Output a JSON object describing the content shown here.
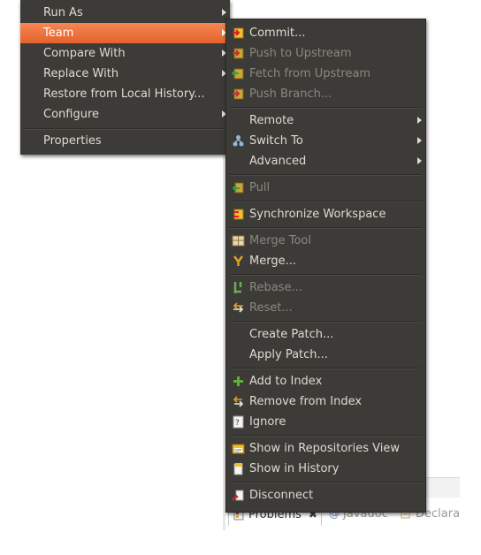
{
  "main_menu": {
    "items": [
      {
        "label": "Run As",
        "has_submenu": true
      },
      {
        "label": "Team",
        "has_submenu": true,
        "highlighted": true
      },
      {
        "label": "Compare With",
        "has_submenu": true
      },
      {
        "label": "Replace With",
        "has_submenu": true
      },
      {
        "label": "Restore from Local History...",
        "has_submenu": false
      },
      {
        "label": "Configure",
        "has_submenu": true
      },
      {
        "label": "Properties",
        "has_submenu": false
      }
    ]
  },
  "team_menu": {
    "items": [
      {
        "label": "Commit...",
        "icon": "commit-icon",
        "enabled": true
      },
      {
        "label": "Push to Upstream",
        "icon": "push-icon",
        "enabled": false
      },
      {
        "label": "Fetch from Upstream",
        "icon": "fetch-icon",
        "enabled": false
      },
      {
        "label": "Push Branch...",
        "icon": "push-branch-icon",
        "enabled": false
      },
      {
        "label": "Remote",
        "enabled": true,
        "has_submenu": true
      },
      {
        "label": "Switch To",
        "icon": "switch-branch-icon",
        "enabled": true,
        "has_submenu": true
      },
      {
        "label": "Advanced",
        "enabled": true,
        "has_submenu": true
      },
      {
        "label": "Pull",
        "icon": "pull-icon",
        "enabled": false
      },
      {
        "label": "Synchronize Workspace",
        "icon": "synchronize-icon",
        "enabled": true
      },
      {
        "label": "Merge Tool",
        "icon": "merge-tool-icon",
        "enabled": false
      },
      {
        "label": "Merge...",
        "icon": "merge-icon",
        "enabled": true
      },
      {
        "label": "Rebase...",
        "icon": "rebase-icon",
        "enabled": false
      },
      {
        "label": "Reset...",
        "icon": "reset-icon",
        "enabled": false
      },
      {
        "label": "Create Patch...",
        "enabled": true
      },
      {
        "label": "Apply Patch...",
        "enabled": true
      },
      {
        "label": "Add to Index",
        "icon": "add-icon",
        "enabled": true
      },
      {
        "label": "Remove from Index",
        "icon": "remove-index-icon",
        "enabled": true
      },
      {
        "label": "Ignore",
        "icon": "ignore-icon",
        "enabled": true
      },
      {
        "label": "Show in Repositories View",
        "icon": "repositories-icon",
        "enabled": true
      },
      {
        "label": "Show in History",
        "icon": "history-icon",
        "enabled": true
      },
      {
        "label": "Disconnect",
        "icon": "disconnect-icon",
        "enabled": true
      }
    ]
  },
  "bottom_tabs": [
    {
      "label": "Problems",
      "icon": "problems-icon",
      "active": true,
      "closable": true
    },
    {
      "label": "Javadoc",
      "icon": "at-icon",
      "active": false
    },
    {
      "label": "Declara",
      "icon": "declaration-icon",
      "active": false
    }
  ],
  "colors": {
    "menu_bg": "#3c3b37",
    "menu_text": "#dfdbd2",
    "disabled_text": "#8a877f",
    "highlight": "#f07746"
  }
}
